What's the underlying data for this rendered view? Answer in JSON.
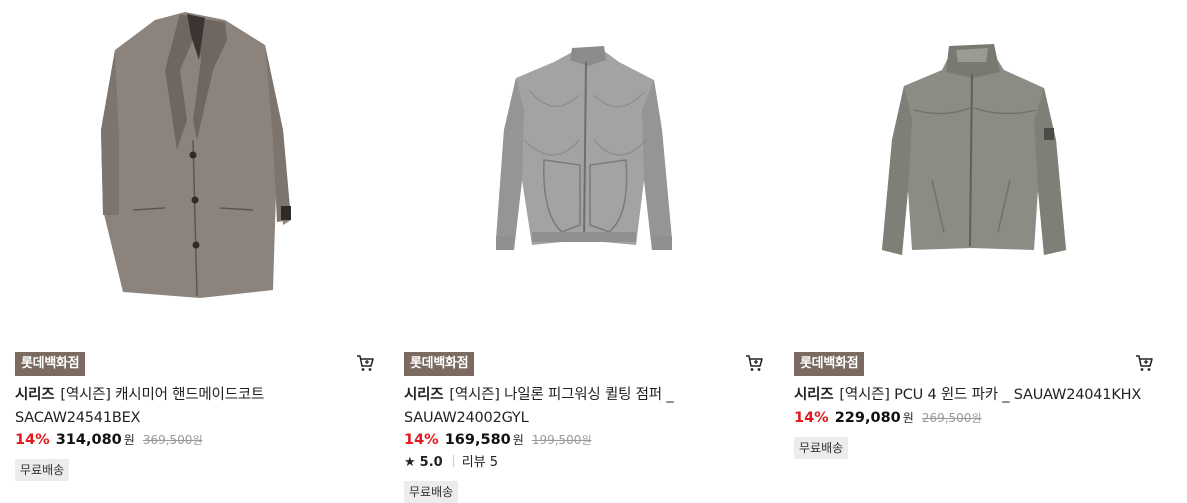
{
  "products": [
    {
      "store": "롯데백화점",
      "brand": "시리즈",
      "name": "[역시즌] 캐시미어 핸드메이드코트 SACAW24541BEX",
      "discount": "14%",
      "sale_price": "314,080",
      "currency": "원",
      "original_price": "369,500",
      "shipping": "무료배송",
      "image_icon": "coat-image"
    },
    {
      "store": "롯데백화점",
      "brand": "시리즈",
      "name": "[역시즌] 나일론 피그워싱 퀼팅 점퍼 _ SAUAW24002GYL",
      "discount": "14%",
      "sale_price": "169,580",
      "currency": "원",
      "original_price": "199,500",
      "rating": "5.0",
      "reviews": "리뷰 5",
      "shipping": "무료배송",
      "image_icon": "quilted-jacket-image"
    },
    {
      "store": "롯데백화점",
      "brand": "시리즈",
      "name": "[역시즌] PCU 4 윈드 파카 _ SAUAW24041KHX",
      "discount": "14%",
      "sale_price": "229,080",
      "currency": "원",
      "original_price": "269,500",
      "shipping": "무료배송",
      "image_icon": "wind-parka-image"
    }
  ],
  "colors": {
    "badge_bg": "#7a6a5f",
    "discount": "#e1191e",
    "coat": "#8c837c",
    "quilted": "#a2a3a3",
    "parka": "#8a8d83"
  }
}
